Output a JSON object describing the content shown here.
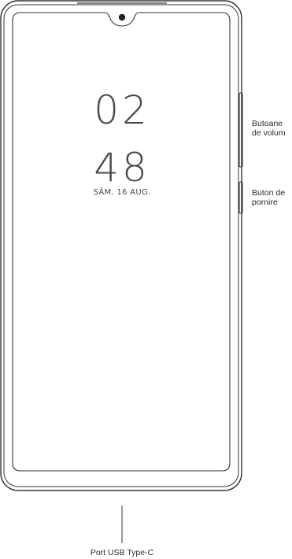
{
  "lock_screen": {
    "hour": "02",
    "minute": "48",
    "date": "SÂM. 16 AUG."
  },
  "callouts": {
    "volume_buttons": "Butoane de volum",
    "power_button": "Buton de pornire",
    "usb_port": "Port USB Type-C"
  },
  "colors": {
    "outline": "#333333",
    "text": "#4a4a4a"
  }
}
